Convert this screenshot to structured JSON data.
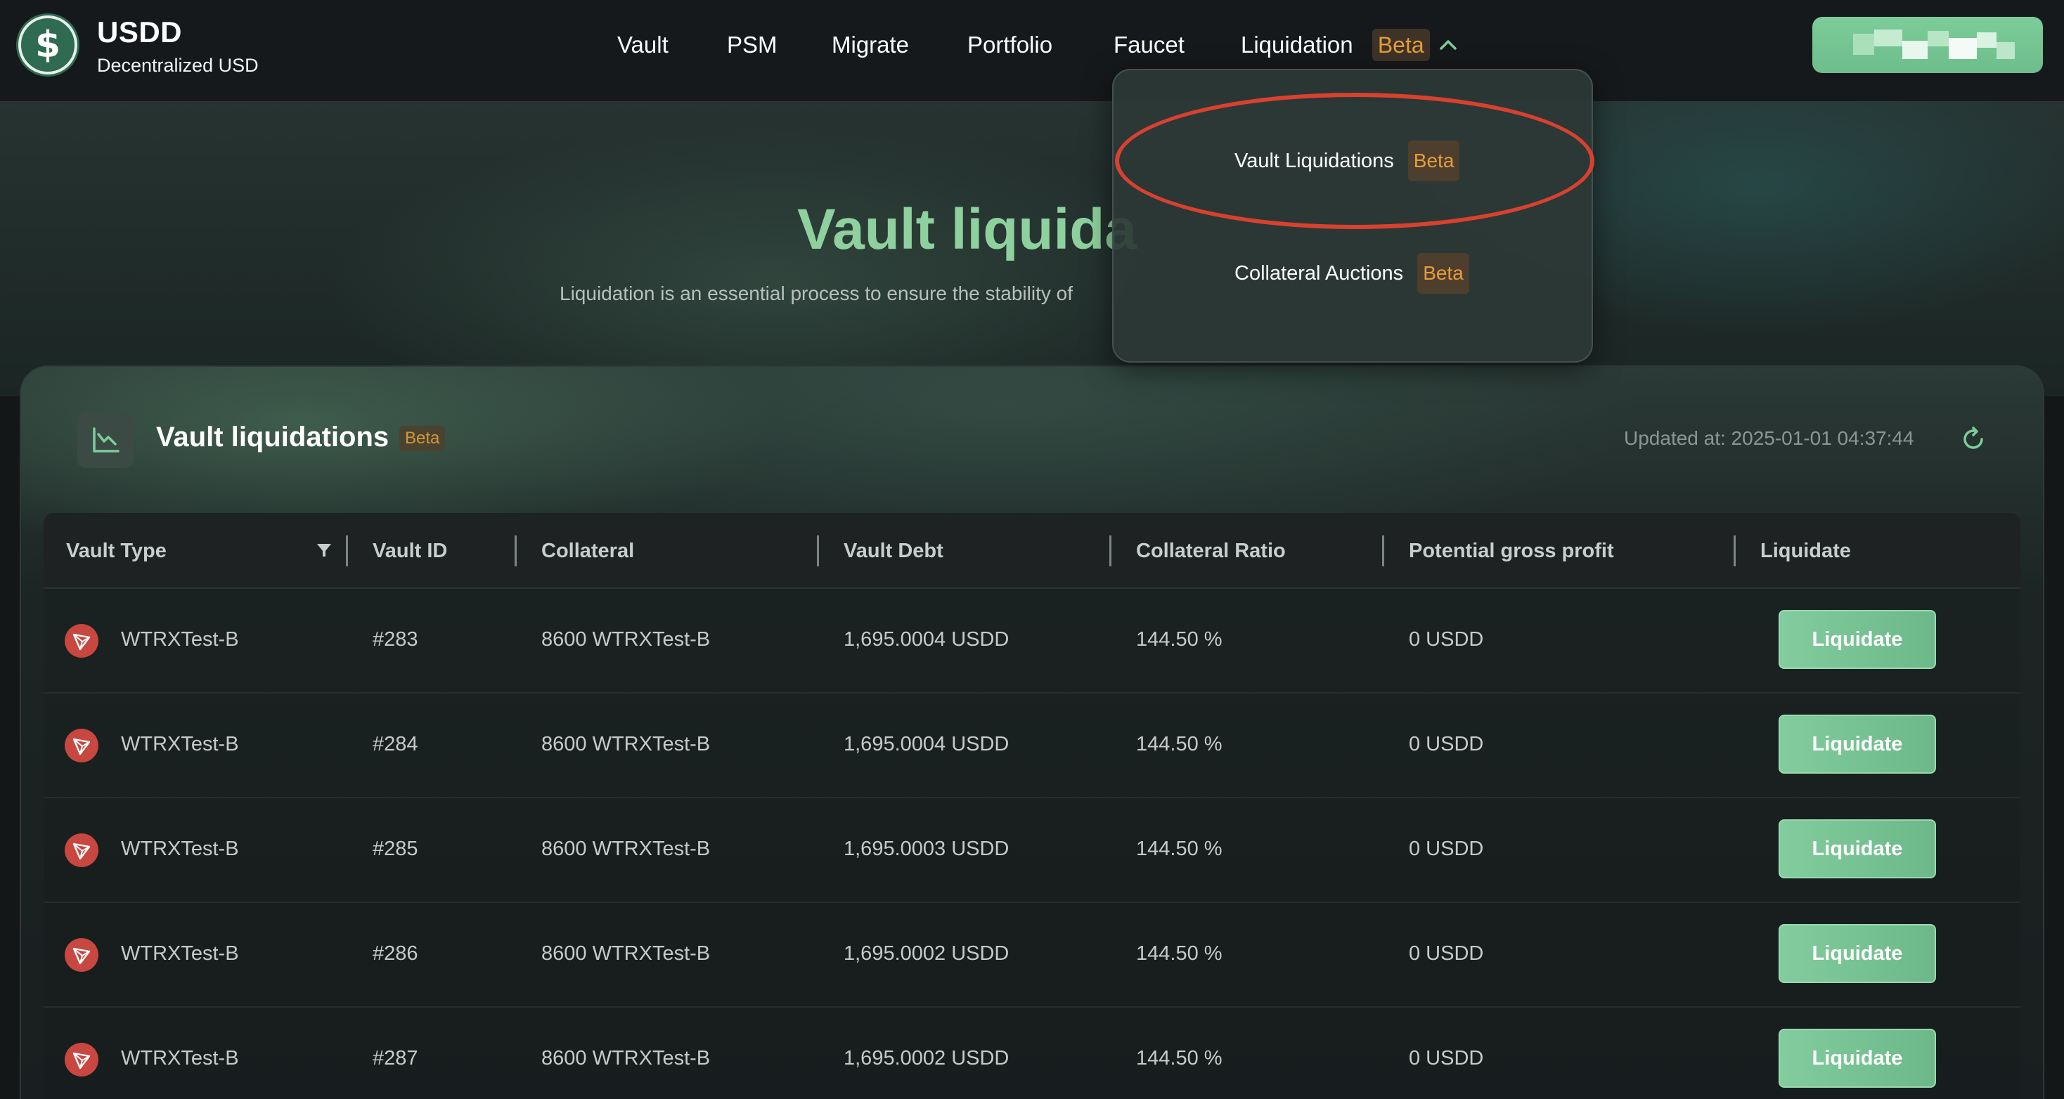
{
  "brand": {
    "name": "USDD",
    "subtitle": "Decentralized USD",
    "logo_glyph": "$"
  },
  "nav": {
    "items": [
      {
        "id": "vault",
        "label": "Vault"
      },
      {
        "id": "psm",
        "label": "PSM"
      },
      {
        "id": "migrate",
        "label": "Migrate"
      },
      {
        "id": "portfolio",
        "label": "Portfolio"
      },
      {
        "id": "faucet",
        "label": "Faucet"
      },
      {
        "id": "liquidation",
        "label": "Liquidation"
      }
    ],
    "liquidation_badge": "Beta",
    "liquidation_icon": "chevron-up-icon"
  },
  "dropdown": {
    "items": [
      {
        "label": "Vault Liquidations",
        "badge": "Beta",
        "highlighted": true
      },
      {
        "label": "Collateral Auctions",
        "badge": "Beta",
        "highlighted": false
      }
    ]
  },
  "hero": {
    "title": "Vault liquida",
    "subtitle": "Liquidation is an essential process to ensure the stability of"
  },
  "panel": {
    "title": "Vault liquidations",
    "badge": "Beta",
    "updated_at": "Updated at: 2025-01-01 04:37:44",
    "icon": "chart-down-icon",
    "refresh_icon": "refresh-icon"
  },
  "table": {
    "columns": [
      "Vault Type",
      "Vault ID",
      "Collateral",
      "Vault Debt",
      "Collateral Ratio",
      "Potential gross profit",
      "Liquidate"
    ],
    "rows": [
      {
        "vault_type": "WTRXTest-B",
        "vault_id": "#283",
        "collateral": "8600 WTRXTest-B",
        "debt": "1,695.0004 USDD",
        "ratio": "144.50 %",
        "profit": "0 USDD",
        "action": "Liquidate"
      },
      {
        "vault_type": "WTRXTest-B",
        "vault_id": "#284",
        "collateral": "8600 WTRXTest-B",
        "debt": "1,695.0004 USDD",
        "ratio": "144.50 %",
        "profit": "0 USDD",
        "action": "Liquidate"
      },
      {
        "vault_type": "WTRXTest-B",
        "vault_id": "#285",
        "collateral": "8600 WTRXTest-B",
        "debt": "1,695.0003 USDD",
        "ratio": "144.50 %",
        "profit": "0 USDD",
        "action": "Liquidate"
      },
      {
        "vault_type": "WTRXTest-B",
        "vault_id": "#286",
        "collateral": "8600 WTRXTest-B",
        "debt": "1,695.0002 USDD",
        "ratio": "144.50 %",
        "profit": "0 USDD",
        "action": "Liquidate"
      },
      {
        "vault_type": "WTRXTest-B",
        "vault_id": "#287",
        "collateral": "8600 WTRXTest-B",
        "debt": "1,695.0002 USDD",
        "ratio": "144.50 %",
        "profit": "0 USDD",
        "action": "Liquidate"
      }
    ]
  },
  "colors": {
    "accent_green": "#7ccd9a",
    "beta_orange": "#e59d3c",
    "highlight_red": "#d8412f",
    "tron_red": "#c84740"
  }
}
